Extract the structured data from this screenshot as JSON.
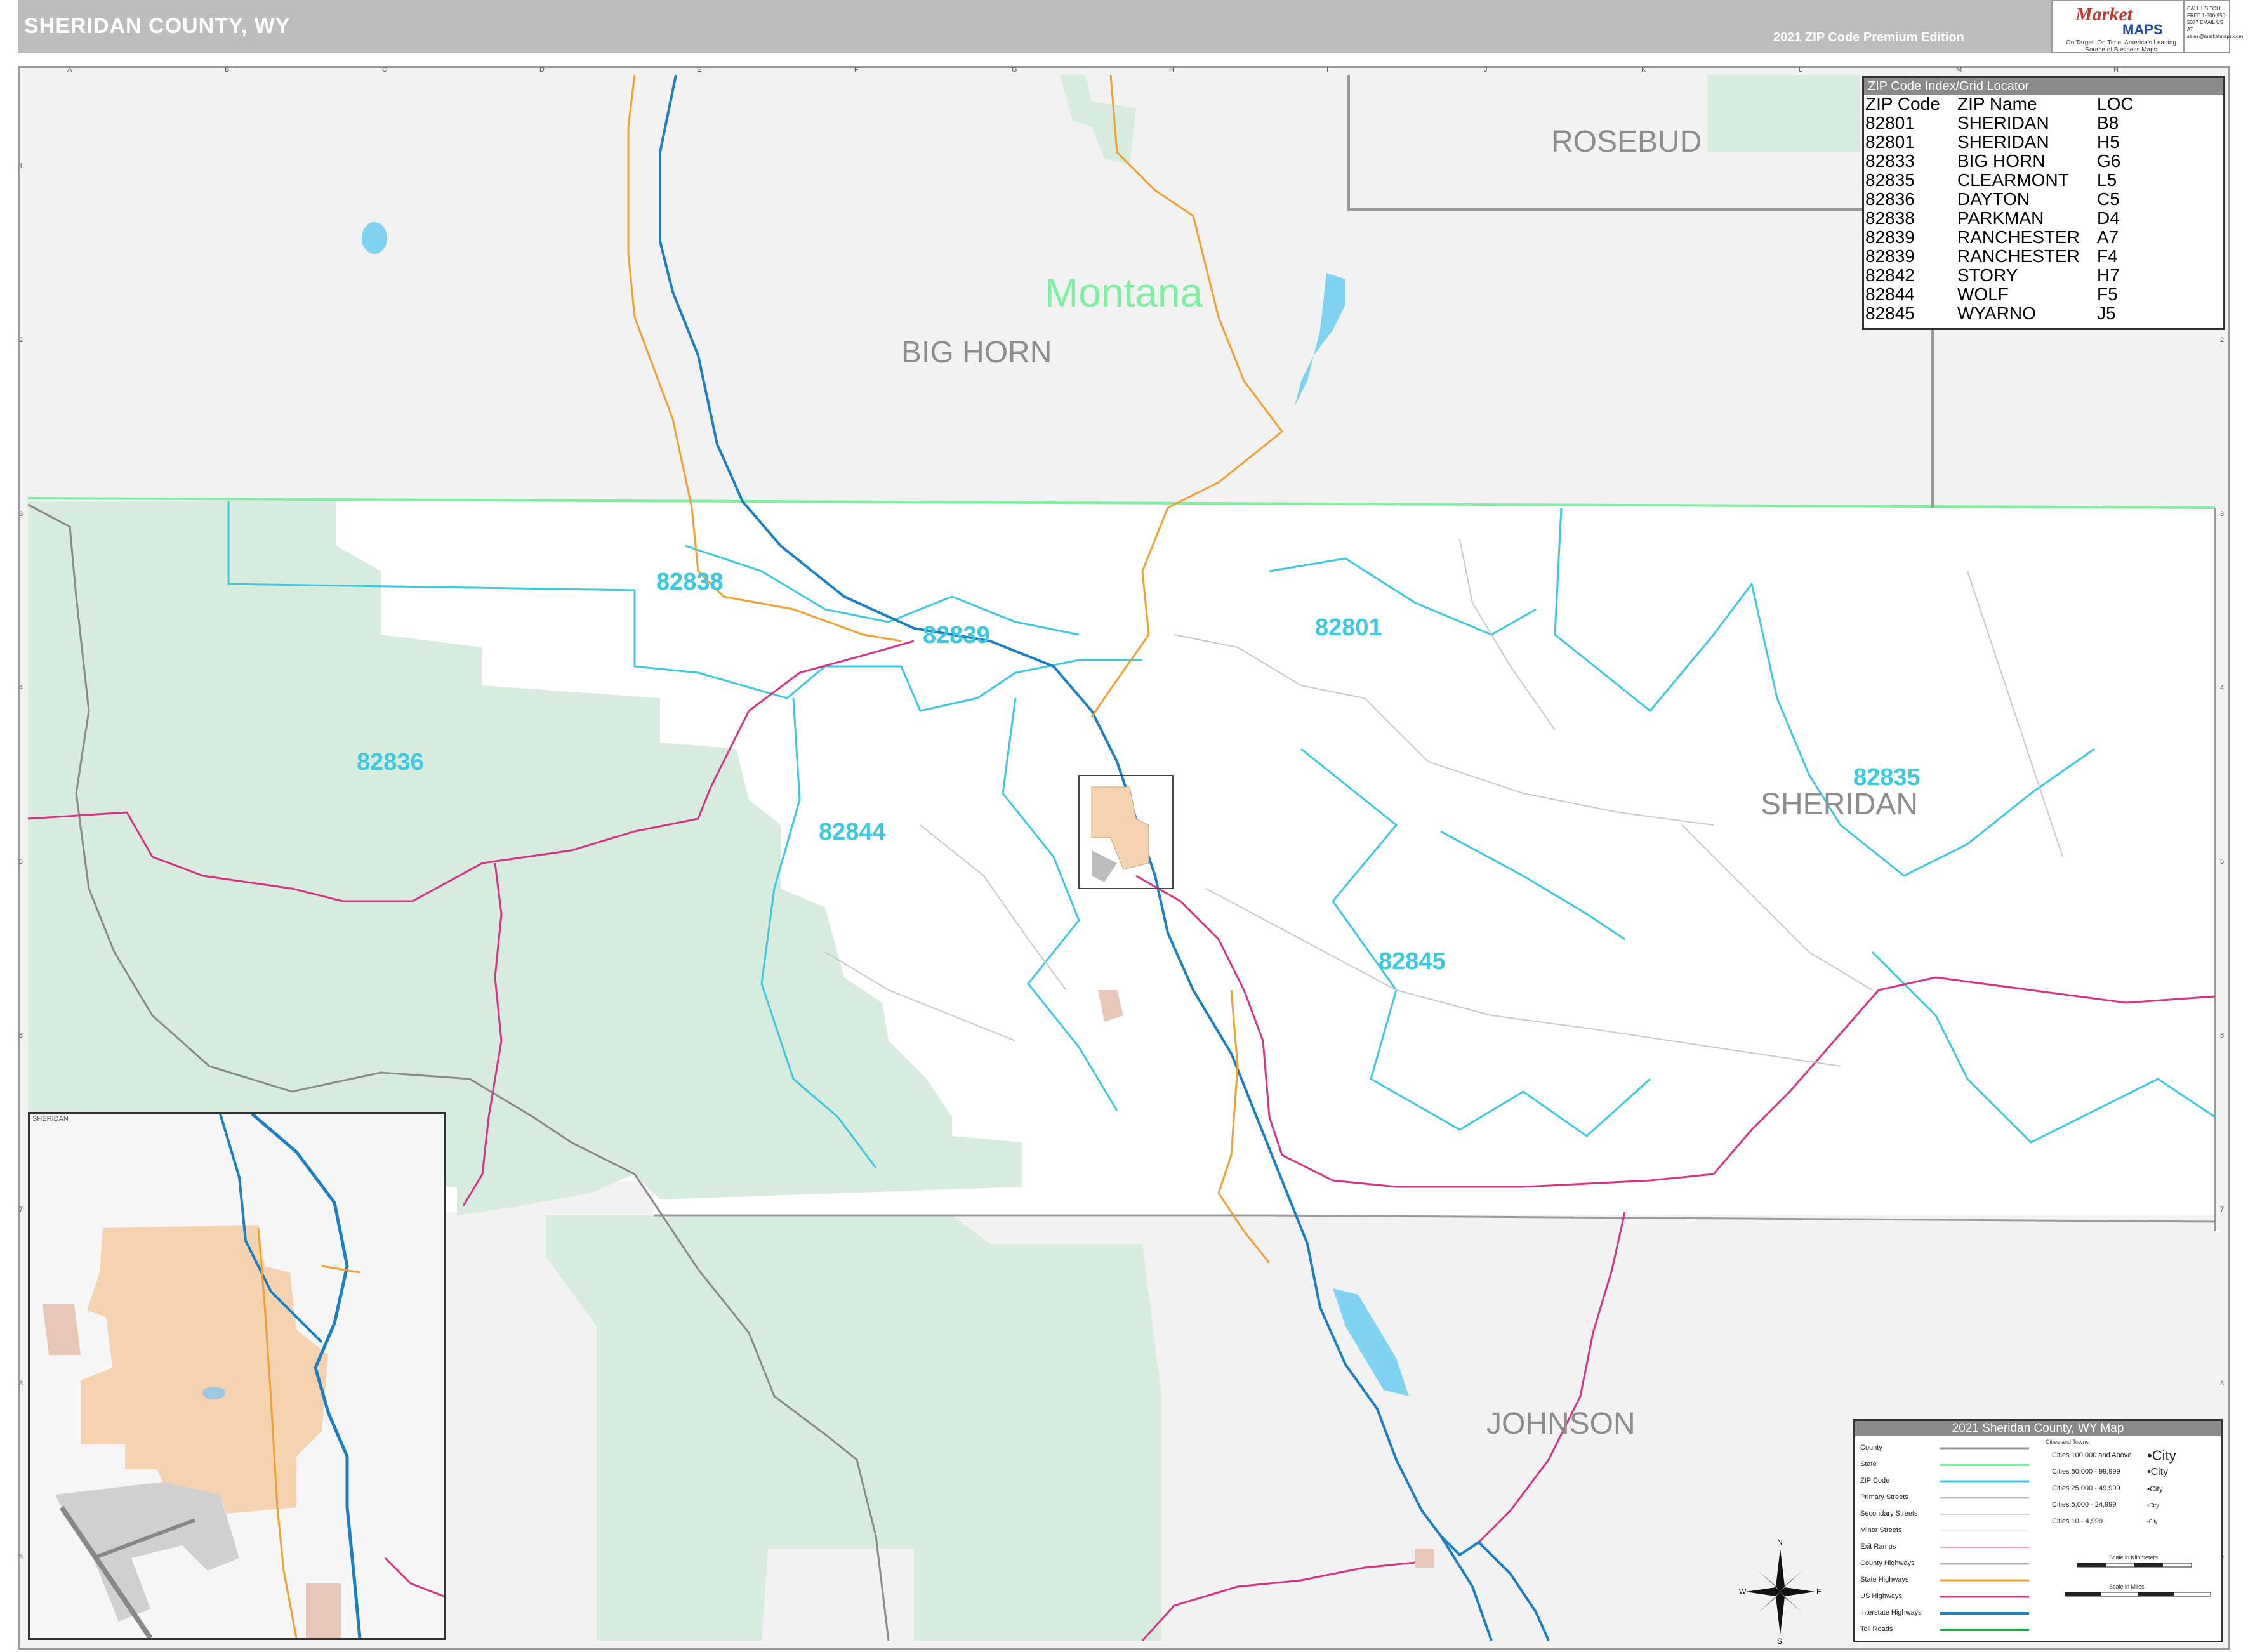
{
  "header": {
    "title": "SHERIDAN COUNTY, WY",
    "edition": "2021 ZIP Code Premium Edition",
    "logo_word": "Market",
    "logo_maps": "MAPS",
    "logo_tagline": "On Target. On Time. America's Leading Source of Business Maps",
    "call_text": "CALL US TOLL FREE 1-800-950-5377 EMAIL US AT sales@marketmaps.com"
  },
  "grid": {
    "columns": [
      "A",
      "B",
      "C",
      "D",
      "E",
      "F",
      "G",
      "H",
      "I",
      "J",
      "K",
      "L",
      "M",
      "N"
    ],
    "rows": [
      "1",
      "2",
      "3",
      "4",
      "5",
      "6",
      "7",
      "8",
      "9"
    ]
  },
  "labels": {
    "state": "Montana",
    "counties": [
      "ROSEBUD",
      "BIG HORN",
      "SHERIDAN",
      "JOHNSON"
    ],
    "zips": [
      "82838",
      "82839",
      "82801",
      "82836",
      "82844",
      "82835",
      "82845"
    ]
  },
  "zip_index": {
    "title": "ZIP Code Index/Grid Locator",
    "headers": [
      "ZIP Code",
      "ZIP Name",
      "LOC"
    ],
    "rows": [
      [
        "82801",
        "SHERIDAN",
        "B8"
      ],
      [
        "82801",
        "SHERIDAN",
        "H5"
      ],
      [
        "82833",
        "BIG HORN",
        "G6"
      ],
      [
        "82835",
        "CLEARMONT",
        "L5"
      ],
      [
        "82836",
        "DAYTON",
        "C5"
      ],
      [
        "82838",
        "PARKMAN",
        "D4"
      ],
      [
        "82839",
        "RANCHESTER",
        "A7"
      ],
      [
        "82839",
        "RANCHESTER",
        "F4"
      ],
      [
        "82842",
        "STORY",
        "H7"
      ],
      [
        "82844",
        "WOLF",
        "F5"
      ],
      [
        "82845",
        "WYARNO",
        "J5"
      ]
    ]
  },
  "inset": {
    "title": "SHERIDAN"
  },
  "legend": {
    "title": "2021 Sheridan County, WY Map",
    "items": [
      "County",
      "State",
      "ZIP Code",
      "Primary Streets",
      "Secondary Streets",
      "Minor Streets",
      "Exit Ramps",
      "County Highways",
      "State Highways",
      "US Highways",
      "Interstate Highways",
      "Toll Roads"
    ],
    "cities_head": "Cities and Towns",
    "cities": [
      {
        "label": "Cities 100,000 and Above",
        "sym": "•City"
      },
      {
        "label": "Cities 50,000 - 99,999",
        "sym": "•City"
      },
      {
        "label": "Cities 25,000 - 49,999",
        "sym": "•City"
      },
      {
        "label": "Cities 5,000 - 24,999",
        "sym": "•City"
      },
      {
        "label": "Cities 10 - 4,999",
        "sym": "•City"
      }
    ],
    "scale_km": "Scale in Kilometers",
    "scale_mi": "Scale in Miles"
  },
  "compass": {
    "n": "N",
    "s": "S",
    "e": "E",
    "w": "W"
  },
  "colors": {
    "national_forest": "#d7ebdf",
    "zip_boundary": "#3cc8e0",
    "state_line": "#7cf09c",
    "interstate": "#1a7fc4",
    "us_highway": "#d63384",
    "state_highway": "#f0a030",
    "county_line": "#9a9a9a",
    "city_area": "#f5d3b0"
  }
}
